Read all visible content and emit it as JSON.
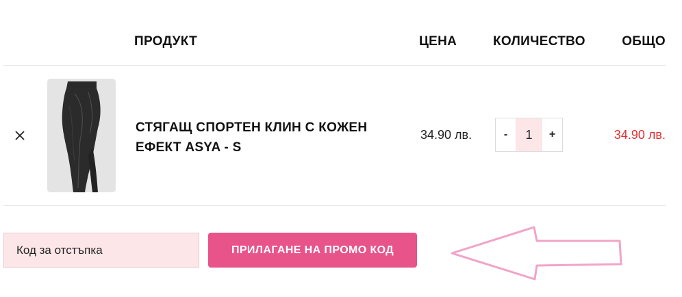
{
  "cart": {
    "headers": {
      "product": "ПРОДУКТ",
      "price": "ЦЕНА",
      "quantity": "КОЛИЧЕСТВО",
      "total": "ОБЩО"
    },
    "items": [
      {
        "remove_icon": "close-icon",
        "name": "СТЯГАЩ СПОРТЕН КЛИН С КОЖЕН ЕФЕКТ ASYA - S",
        "price": "34.90 лв.",
        "quantity": "1",
        "qty_minus": "-",
        "qty_plus": "+",
        "total": "34.90 лв."
      }
    ]
  },
  "coupon": {
    "placeholder": "Код за отстъпка",
    "apply_label": "ПРИЛАГАНЕ НА ПРОМО КОД"
  },
  "colors": {
    "accent": "#e8538a",
    "total_red": "#e02f2f",
    "input_bg": "#fce6e8",
    "arrow_stroke": "#f2a3c8"
  }
}
